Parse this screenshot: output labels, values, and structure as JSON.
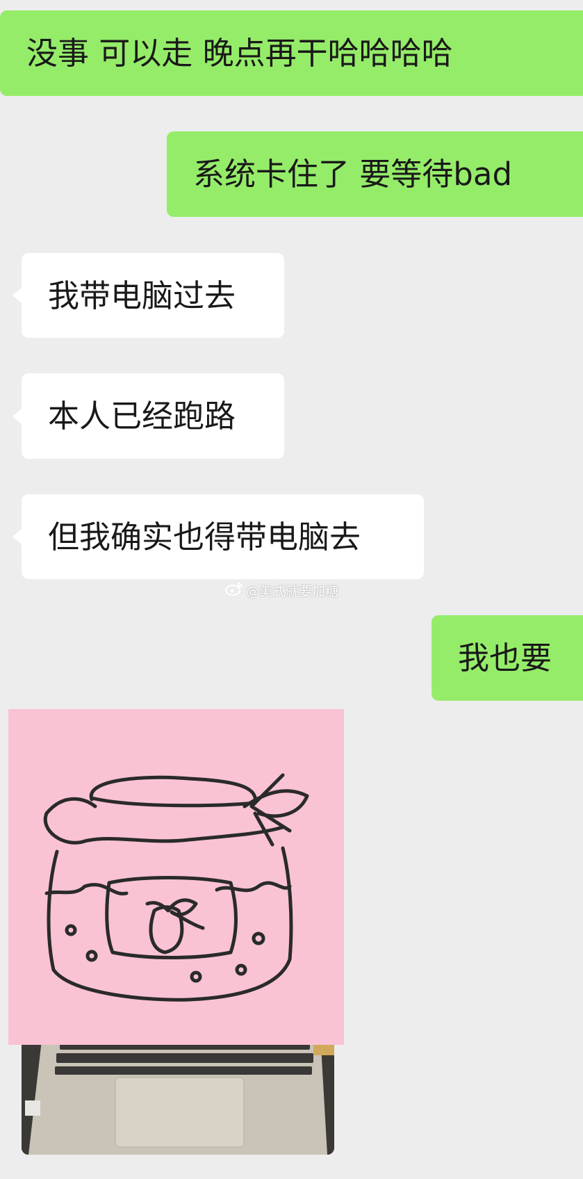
{
  "messages": [
    {
      "side": "out",
      "text": "没事 可以走 晚点再干哈哈哈哈"
    },
    {
      "side": "out",
      "text": "系统卡住了 要等待bad"
    },
    {
      "side": "in",
      "text": "我带电脑过去"
    },
    {
      "side": "in",
      "text": "本人已经跑路"
    },
    {
      "side": "in",
      "text": "但我确实也得带电脑去"
    },
    {
      "side": "out",
      "text": "我也要"
    }
  ],
  "watermark": {
    "text": "@美式就要加糖",
    "icon": "weibo-icon"
  },
  "sticker": {
    "icon": "strawberry-jam-jar-drawing",
    "background": "#f9c3d4"
  },
  "photo": {
    "subject": "laptop-keyboard-photo"
  },
  "colors": {
    "background": "#ededed",
    "outgoing": "#95ec69",
    "incoming": "#ffffff"
  }
}
